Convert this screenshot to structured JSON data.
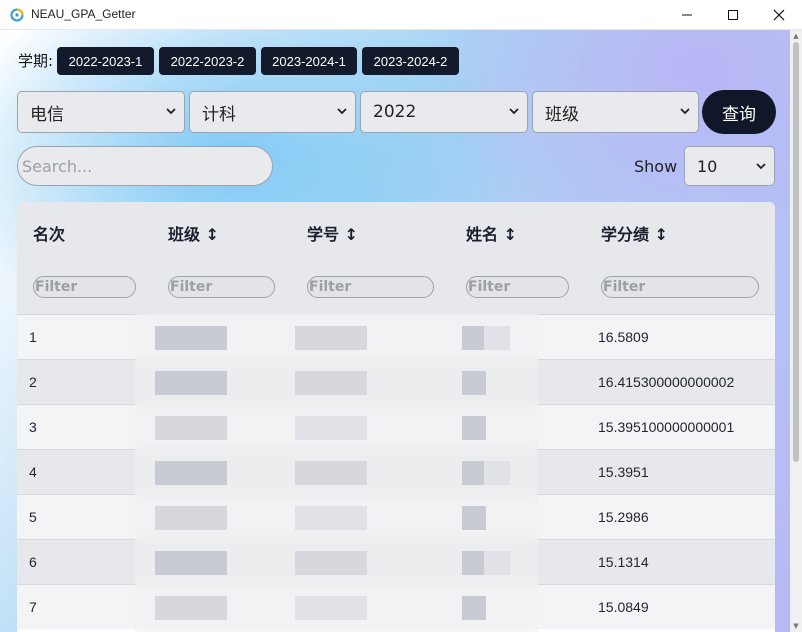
{
  "window": {
    "title": "NEAU_GPA_Getter",
    "controls": [
      "minimize",
      "maximize",
      "close"
    ]
  },
  "terms": {
    "label": "学期:",
    "buttons": [
      "2022-2023-1",
      "2022-2023-2",
      "2023-2024-1",
      "2023-2024-2"
    ]
  },
  "filters": {
    "college": "电信",
    "major": "计科",
    "grade": "2022",
    "class": "班级",
    "query_label": "查询"
  },
  "search": {
    "placeholder": "Search..."
  },
  "page_size": {
    "label": "Show",
    "value": "10"
  },
  "table": {
    "columns": [
      "名次",
      "班级 ↕",
      "学号 ↕",
      "姓名 ↕",
      "学分绩 ↕"
    ],
    "filter_placeholder": "Filter",
    "rows": [
      {
        "rank": "1",
        "score": "16.5809"
      },
      {
        "rank": "2",
        "score": "16.415300000000002"
      },
      {
        "rank": "3",
        "score": "15.395100000000001"
      },
      {
        "rank": "4",
        "score": "15.3951"
      },
      {
        "rank": "5",
        "score": "15.2986"
      },
      {
        "rank": "6",
        "score": "15.1314"
      },
      {
        "rank": "7",
        "score": "15.0849"
      }
    ]
  },
  "colors": {
    "dark_button": "#131a2b",
    "query_button": "#0f1728",
    "control_bg": "#e8eaed",
    "table_header_bg": "#e6e8ec"
  }
}
